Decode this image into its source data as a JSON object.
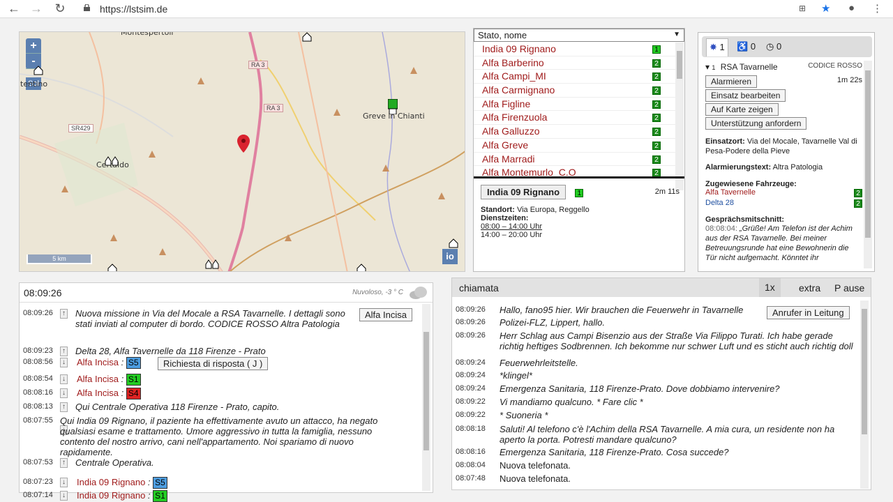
{
  "browser": {
    "url": "https://lstsim.de"
  },
  "map": {
    "labels": [
      "Montespertoli",
      "tentino",
      "Greve in Chianti",
      "Certaldo"
    ],
    "roads": [
      "RA 3",
      "RA 3",
      "SR429"
    ],
    "scale": "5 km",
    "zoom_in": "+",
    "zoom_out": "-",
    "sol": "Sol",
    "io": "io"
  },
  "vehicle_list": {
    "sort_select": "Stato, nome",
    "items": [
      {
        "name": "India 09 Rignano",
        "status": "1"
      },
      {
        "name": "Alfa Barberino",
        "status": "2"
      },
      {
        "name": "Alfa Campi_MI",
        "status": "2"
      },
      {
        "name": "Alfa Carmignano",
        "status": "2"
      },
      {
        "name": "Alfa Figline",
        "status": "2"
      },
      {
        "name": "Alfa Firenzuola",
        "status": "2"
      },
      {
        "name": "Alfa Galluzzo",
        "status": "2"
      },
      {
        "name": "Alfa Greve",
        "status": "2"
      },
      {
        "name": "Alfa Marradi",
        "status": "2"
      },
      {
        "name": "Alfa Montemurlo_C.O",
        "status": "2"
      }
    ],
    "detail": {
      "name": "India 09 Rignano",
      "status": "1",
      "timer": "2m 11s",
      "standort_label": "Standort:",
      "standort": "Via Europa, Reggello",
      "dienst_label": "Dienstzeiten:",
      "shift1": "08:00 – 14:00 Uhr",
      "shift2": "14:00 – 20:00 Uhr"
    }
  },
  "mission": {
    "tabs": [
      {
        "count": "1"
      },
      {
        "count": "0"
      },
      {
        "count": "0"
      }
    ],
    "number": "1",
    "title": "RSA Tavarnelle",
    "code": "CODICE ROSSO",
    "timer": "1m 22s",
    "buttons": [
      "Alarmieren",
      "Einsatz bearbeiten",
      "Auf Karte zeigen",
      "Unterstützung anfordern"
    ],
    "einsatzort_label": "Einsatzort:",
    "einsatzort": "Via del Mocale, Tavarnelle Val di Pesa-Podere della Pieve",
    "alarm_label": "Alarmierungstext:",
    "alarm": "Altra Patologia",
    "vehicles_label": "Zugewiesene Fahrzeuge:",
    "vehicles": [
      {
        "name": "Alfa Tavernelle",
        "status": "2"
      },
      {
        "name": "Delta 28",
        "status": "2"
      }
    ],
    "gespraech_label": "Gesprächsmitschnitt:",
    "gespraech_time": "08:08:04:",
    "gespraech": "„Grüße! Am Telefon ist der Achim aus der RSA Tavarnelle. Bei meiner Betreuungsrunde hat eine Bewohnerin die Tür nicht aufgemacht. Könntet ihr"
  },
  "log": {
    "clock": "08:09:26",
    "weather": "Nuvoloso, -3 ° C",
    "rows": [
      {
        "time": "08:09:26",
        "arrow": "↑",
        "text": "Nuova missione in Via del Mocale a RSA Tavarnelle. I dettagli sono stati inviati al computer di bordo. CODICE ROSSO Altra Patologia",
        "btn": "Alfa Incisa"
      },
      {
        "time": "08:09:23",
        "arrow": "↑",
        "text": "Delta 28, Alfa Tavernelle da 118 Firenze - Prato"
      },
      {
        "time": "08:08:56",
        "arrow": "↓",
        "unit": "Alfa Incisa",
        "status": "S5",
        "btn": "Richiesta di risposta ( J )"
      },
      {
        "time": "08:08:54",
        "arrow": "↓",
        "unit": "Alfa Incisa",
        "status": "S1"
      },
      {
        "time": "08:08:16",
        "arrow": "↓",
        "unit": "Alfa Incisa",
        "status": "S4"
      },
      {
        "time": "08:08:13",
        "arrow": "↑",
        "text": "Qui Centrale Operativa 118 Firenze - Prato, capito."
      },
      {
        "time": "08:07:55",
        "arrow": "↓",
        "text": "Qui India 09 Rignano, il paziente ha effettivamente avuto un attacco, ha negato qualsiasi esame e trattamento. Umore aggressivo in tutta la famiglia, nessuno contento del nostro arrivo, cani nell'appartamento. Noi spariamo di nuovo rapidamente."
      },
      {
        "time": "08:07:53",
        "arrow": "↑",
        "text": "Centrale Operativa."
      },
      {
        "time": "08:07:23",
        "arrow": "↓",
        "unit": "India 09 Rignano",
        "status": "S5"
      },
      {
        "time": "08:07:14",
        "arrow": "↓",
        "unit": "India 09 Rignano",
        "status": "S1"
      }
    ]
  },
  "call": {
    "title": "chiamata",
    "speed": "1x",
    "extra": "extra",
    "pause": "P ause",
    "caller_btn": "Anrufer in Leitung",
    "rows": [
      {
        "time": "08:09:26",
        "text": "Hallo, fano95 hier. Wir brauchen die Feuerwehr in Tavarnelle"
      },
      {
        "time": "08:09:26",
        "text": "Polizei-FLZ, Lippert, hallo."
      },
      {
        "time": "08:09:26",
        "text": "Herr Schlag aus Campi Bisenzio aus der Straße Via Filippo Turati. Ich habe gerade richtig heftiges Sodbrennen. Ich bekomme nur schwer Luft und es sticht auch richtig doll in meiner Brust. Schicken Sie mal jemanden vorbei!"
      },
      {
        "time": "08:09:24",
        "text": "Feuerwehrleitstelle."
      },
      {
        "time": "08:09:24",
        "text": "*klingel*"
      },
      {
        "time": "08:09:24",
        "text": "Emergenza Sanitaria, 118 Firenze-Prato. Dove dobbiamo intervenire?"
      },
      {
        "time": "08:09:22",
        "text": "Vi mandiamo qualcuno. * Fare clic *"
      },
      {
        "time": "08:09:22",
        "text": "* Suoneria *"
      },
      {
        "time": "08:08:18",
        "text": "Saluti! Al telefono c'è l'Achim della RSA Tavarnelle. A mia cura, un residente non ha aperto la porta. Potresti mandare qualcuno?"
      },
      {
        "time": "08:08:16",
        "text": "Emergenza Sanitaria, 118 Firenze-Prato. Cosa succede?"
      },
      {
        "time": "08:08:04",
        "text": "Nuova telefonata."
      },
      {
        "time": "08:07:48",
        "text": "Nuova telefonata."
      }
    ]
  }
}
